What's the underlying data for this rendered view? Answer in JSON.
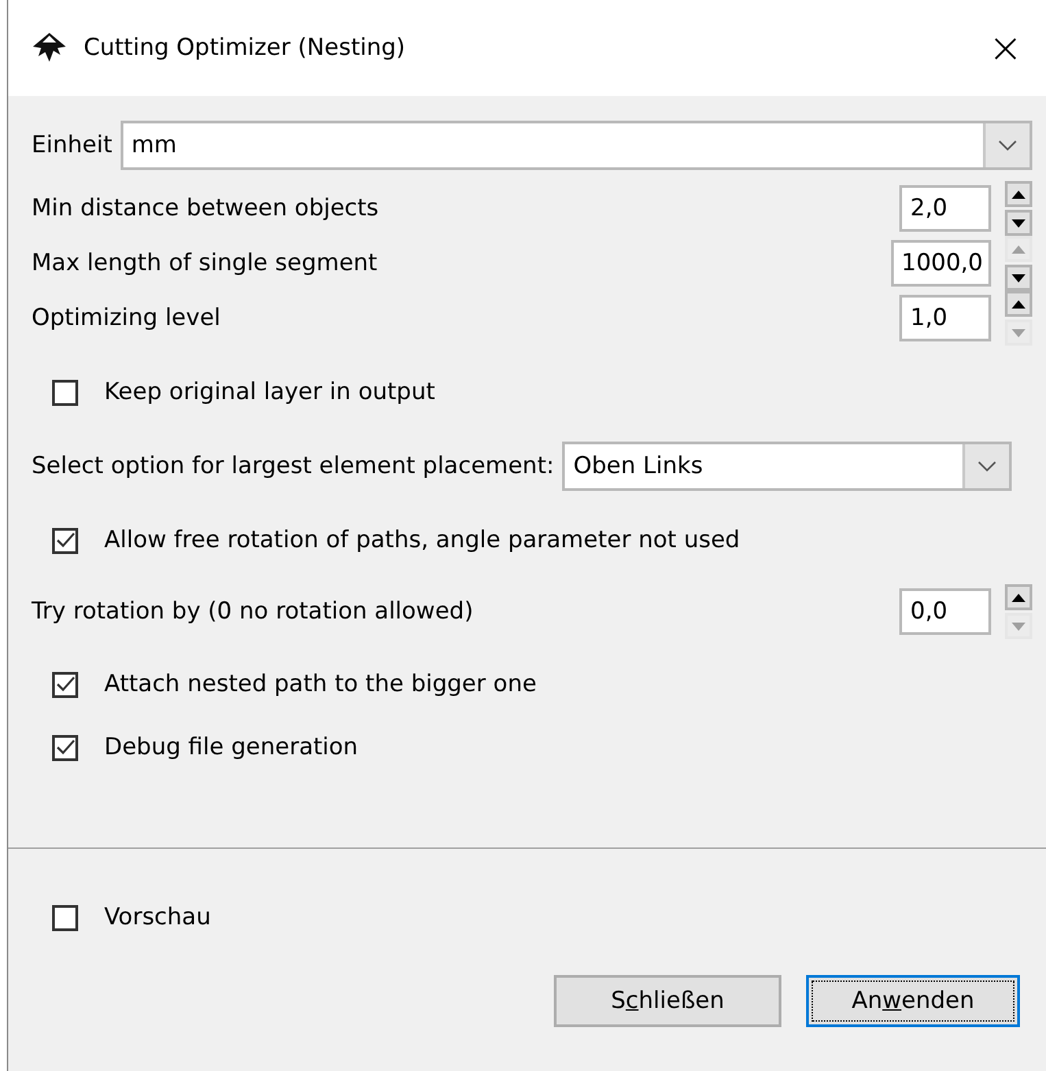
{
  "window": {
    "title": "Cutting Optimizer (Nesting)",
    "close": "×"
  },
  "unit": {
    "label": "Einheit",
    "value": "mm"
  },
  "spinners": [
    {
      "label": "Min distance between objects",
      "value": "2,0",
      "up_enabled": true,
      "down_enabled": true
    },
    {
      "label": "Max length of single segment",
      "value": "1000,0",
      "up_enabled": false,
      "down_enabled": true
    },
    {
      "label": "Optimizing level",
      "value": "1,0",
      "up_enabled": true,
      "down_enabled": false
    }
  ],
  "keep_layer": {
    "label": "Keep original layer in output",
    "checked": false
  },
  "placement": {
    "label": "Select option for largest element placement:",
    "value": "Oben Links"
  },
  "free_rotation": {
    "label": "Allow free rotation of paths, angle parameter not used",
    "checked": true
  },
  "rotation": {
    "label": "Try rotation by (0 no rotation allowed)",
    "value": "0,0",
    "up_enabled": true,
    "down_enabled": false
  },
  "options": [
    {
      "label": "Attach nested path to the bigger one",
      "checked": true
    },
    {
      "label": "Debug file generation",
      "checked": true
    }
  ],
  "preview": {
    "label": "Vorschau",
    "checked": false
  },
  "buttons": [
    {
      "before": "S",
      "key": "c",
      "after": "hließen",
      "default": false
    },
    {
      "before": "An",
      "key": "w",
      "after": "enden",
      "default": true
    }
  ]
}
